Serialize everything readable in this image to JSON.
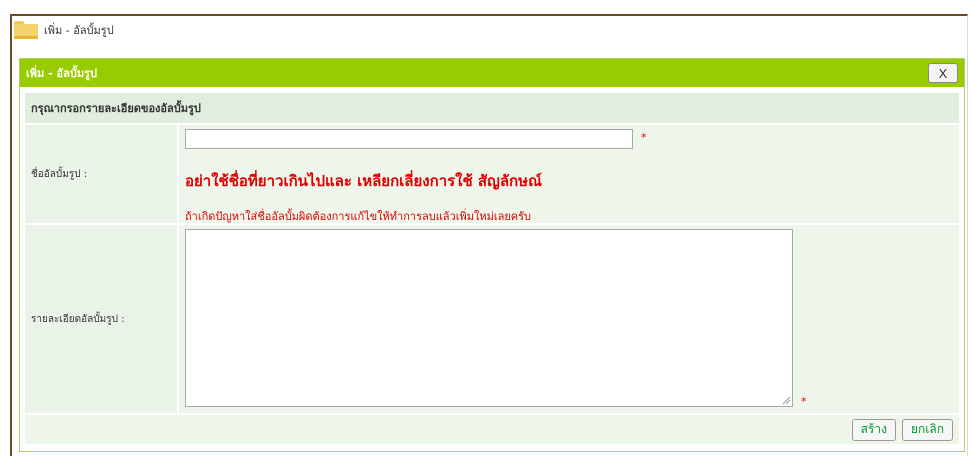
{
  "page": {
    "title": "เพิ่ม - อัลบั้มรูป"
  },
  "dialog": {
    "title": "เพิ่ม - อัลบั้มรูป",
    "close_label": "X",
    "section_heading": "กรุณากรอกรายละเอียดของอัลบั้มรูป",
    "name_field": {
      "label": "ชื่ออัลบั้มรูป :",
      "value": "",
      "required_mark": "*",
      "warning": "อย่าใช้ชื่อที่ยาวเกินไปและ เหลียกเลี่ยงการใช้ สัญลักษณ์",
      "hint": "ถ้าเกิดปัญหาใส่ชื่ออัลบั้มผิดต้องการแก้ไขให้ทำการลบแล้วเพิ่มใหม่เลยครับ"
    },
    "description_field": {
      "label": "รายละเอียดอัลบั้มรูป :",
      "value": "",
      "required_mark": "*"
    },
    "buttons": {
      "create": "สร้าง",
      "cancel": "ยกเลิก"
    }
  },
  "colors": {
    "accent": "#99cc00",
    "warning": "#e00000",
    "button_text": "#009933",
    "frame": "#6b4a21"
  },
  "icons": {
    "page": "folder-icon",
    "close": "close-icon"
  }
}
